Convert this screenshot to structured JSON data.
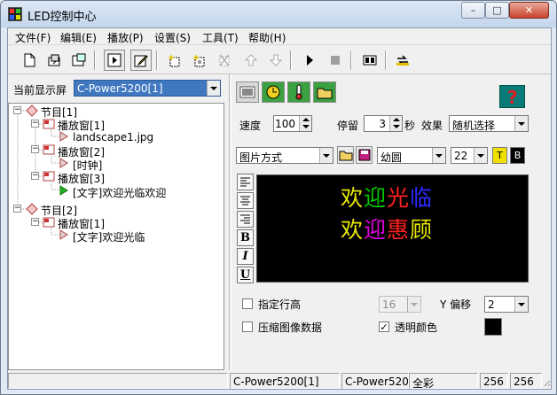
{
  "window": {
    "title": "LED控制中心",
    "caption_buttons": {
      "minimize": "–",
      "maximize": "□",
      "close": "✕"
    }
  },
  "menu": [
    "文件(F)",
    "编辑(E)",
    "播放(P)",
    "设置(S)",
    "工具(T)",
    "帮助(H)"
  ],
  "toolbar": [
    "new-icon",
    "open-icon",
    "save-icon",
    "preview-icon",
    "edit-icon",
    "add-program-icon",
    "add-window-icon",
    "delete-icon",
    "move-up-icon",
    "move-down-icon",
    "play-icon",
    "stop-icon",
    "screen-settings-icon",
    "send-icon"
  ],
  "screen_select": {
    "label": "当前显示屏",
    "value": "C-Power5200[1]"
  },
  "tree": [
    {
      "text": "节目[1]",
      "level": 0,
      "icon": "program-icon"
    },
    {
      "text": "播放窗[1]",
      "level": 1,
      "icon": "window-icon"
    },
    {
      "text": "landscape1.jpg",
      "level": 2,
      "icon": "item-icon"
    },
    {
      "text": "播放窗[2]",
      "level": 1,
      "icon": "window-icon"
    },
    {
      "text": "[时钟]",
      "level": 2,
      "icon": "item-icon"
    },
    {
      "text": "播放窗[3]",
      "level": 1,
      "icon": "window-icon"
    },
    {
      "text": "[文字]欢迎光临欢迎",
      "level": 2,
      "icon": "item-playing-icon"
    },
    {
      "text": "节目[2]",
      "level": 0,
      "icon": "program-icon"
    },
    {
      "text": "播放窗[1]",
      "level": 1,
      "icon": "window-icon"
    },
    {
      "text": "[文字]欢迎光临",
      "level": 2,
      "icon": "item-icon"
    }
  ],
  "tabs": [
    "image-tab-icon",
    "clock-tab-icon",
    "temperature-tab-icon",
    "open-file-tab-icon"
  ],
  "help": {
    "label": "?"
  },
  "speed": {
    "label": "速度",
    "value": "100"
  },
  "stay": {
    "label": "停留",
    "value": "3",
    "unit": "秒"
  },
  "effect": {
    "label": "效果",
    "value": "随机选择"
  },
  "mode": {
    "value": "图片方式"
  },
  "font": {
    "value": "幼圆"
  },
  "font_size": {
    "value": "22"
  },
  "color_buttons": {
    "text": "T",
    "bg": "B"
  },
  "format_buttons": [
    "align-left-icon",
    "align-center-icon",
    "align-right-icon",
    "B",
    "I",
    "U"
  ],
  "preview": {
    "lines": [
      [
        {
          "ch": "欢",
          "color": "#e8e800"
        },
        {
          "ch": "迎",
          "color": "#00c800"
        },
        {
          "ch": "光",
          "color": "#ff2020"
        },
        {
          "ch": "临",
          "color": "#2a2aff"
        }
      ],
      [
        {
          "ch": "欢",
          "color": "#e8e800"
        },
        {
          "ch": "迎",
          "color": "#e000e0"
        },
        {
          "ch": "惠",
          "color": "#ff2020"
        },
        {
          "ch": "顾",
          "color": "#e8e800"
        }
      ]
    ]
  },
  "line_height": {
    "label": "指定行高",
    "checked": false,
    "value": "16"
  },
  "y_offset": {
    "label": "Y 偏移",
    "value": "2"
  },
  "compress": {
    "label": "压缩图像数据",
    "checked": false
  },
  "transparent": {
    "label": "透明颜色",
    "checked": true,
    "color": "#000000"
  },
  "statusbar": [
    "",
    "C-Power5200[1]",
    "C-Power5200",
    "全彩",
    "256",
    "256"
  ]
}
